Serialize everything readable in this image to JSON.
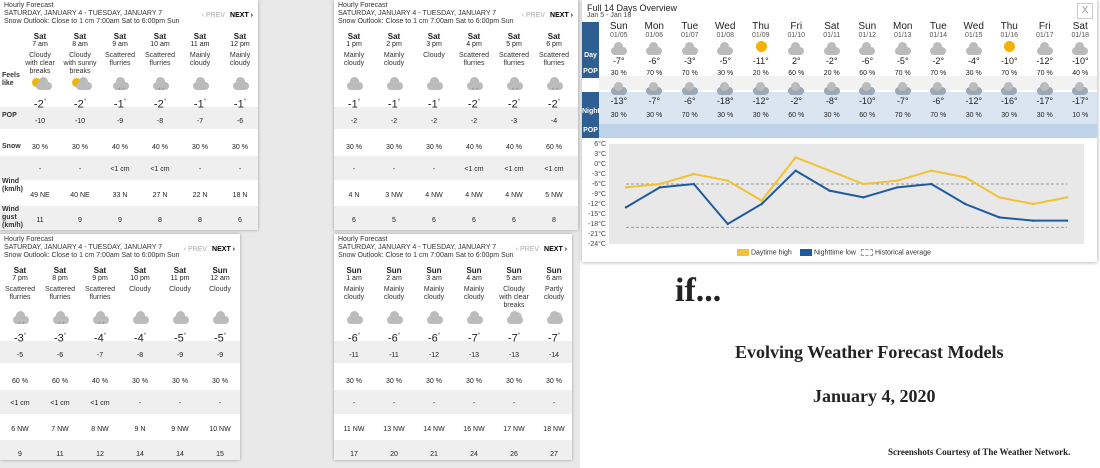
{
  "panels": [
    {
      "id": "p1",
      "title": "Hourly Forecast",
      "range": "SATURDAY, JANUARY 4 - TUESDAY, JANUARY 7",
      "outlook": "Snow Outlook: Close to 1 cm 7:00am Sat to 6:00pm Sun",
      "prev": "‹ PREV",
      "next": "NEXT ›",
      "labels": [
        "Feels like",
        "POP",
        "Snow",
        "Wind (km/h)",
        "Wind gust (km/h)"
      ],
      "cols": [
        {
          "day": "Sat",
          "time": "7 am",
          "cond": "Cloudy with clear breaks",
          "icon": "cloud-sun-icon",
          "temp": "-2",
          "feels": "-10",
          "pop": "30 %",
          "snow": "-",
          "wind": "49 NE",
          "gust": "11"
        },
        {
          "day": "Sat",
          "time": "8 am",
          "cond": "Cloudy with sunny breaks",
          "icon": "cloud-sun-icon",
          "temp": "-2",
          "feels": "-10",
          "pop": "30 %",
          "snow": "-",
          "wind": "40 NE",
          "gust": "9"
        },
        {
          "day": "Sat",
          "time": "9 am",
          "cond": "Scattered flurries",
          "icon": "flurries-icon",
          "temp": "-1",
          "feels": "-9",
          "pop": "40 %",
          "snow": "<1 cm",
          "wind": "33 N",
          "gust": "9"
        },
        {
          "day": "Sat",
          "time": "10 am",
          "cond": "Scattered flurries",
          "icon": "flurries-icon",
          "temp": "-2",
          "feels": "-8",
          "pop": "40 %",
          "snow": "<1 cm",
          "wind": "27 N",
          "gust": "8"
        },
        {
          "day": "Sat",
          "time": "11 am",
          "cond": "Mainly cloudy",
          "icon": "cloud-icon",
          "temp": "-1",
          "feels": "-7",
          "pop": "30 %",
          "snow": "-",
          "wind": "22 N",
          "gust": "8"
        },
        {
          "day": "Sat",
          "time": "12 pm",
          "cond": "Mainly cloudy",
          "icon": "cloud-icon",
          "temp": "-1",
          "feels": "-6",
          "pop": "30 %",
          "snow": "-",
          "wind": "18 N",
          "gust": "6"
        }
      ]
    },
    {
      "id": "p2",
      "title": "Hourly Forecast",
      "range": "SATURDAY, JANUARY 4 - TUESDAY, JANUARY 7",
      "outlook": "Snow Outlook: Close to 1 cm 7:00am Sat to 6:00pm Sun",
      "prev": "‹ PREV",
      "next": "NEXT ›",
      "cols": [
        {
          "day": "Sat",
          "time": "1 pm",
          "cond": "Mainly cloudy",
          "icon": "cloud-icon",
          "temp": "-1",
          "feels": "-2",
          "pop": "30 %",
          "snow": "-",
          "wind": "4 N",
          "gust": "6"
        },
        {
          "day": "Sat",
          "time": "2 pm",
          "cond": "Mainly cloudy",
          "icon": "cloud-icon",
          "temp": "-1",
          "feels": "-2",
          "pop": "30 %",
          "snow": "-",
          "wind": "3 NW",
          "gust": "5"
        },
        {
          "day": "Sat",
          "time": "3 pm",
          "cond": "Cloudy",
          "icon": "cloud-icon",
          "temp": "-1",
          "feels": "-2",
          "pop": "30 %",
          "snow": "-",
          "wind": "4 NW",
          "gust": "6"
        },
        {
          "day": "Sat",
          "time": "4 pm",
          "cond": "Scattered flurries",
          "icon": "flurries-icon",
          "temp": "-2",
          "feels": "-2",
          "pop": "40 %",
          "snow": "<1 cm",
          "wind": "4 NW",
          "gust": "6"
        },
        {
          "day": "Sat",
          "time": "5 pm",
          "cond": "Scattered flurries",
          "icon": "flurries-icon",
          "temp": "-2",
          "feels": "-3",
          "pop": "40 %",
          "snow": "<1 cm",
          "wind": "4 NW",
          "gust": "6"
        },
        {
          "day": "Sat",
          "time": "6 pm",
          "cond": "Scattered flurries",
          "icon": "flurries-icon",
          "temp": "-2",
          "feels": "-4",
          "pop": "60 %",
          "snow": "<1 cm",
          "wind": "5 NW",
          "gust": "8"
        }
      ]
    },
    {
      "id": "p3",
      "title": "Hourly Forecast",
      "range": "SATURDAY, JANUARY 4 - TUESDAY, JANUARY 7",
      "outlook": "Snow Outlook: Close to 1 cm 7:00am Sat to 6:00pm Sun",
      "prev": "‹ PREV",
      "next": "NEXT ›",
      "cols": [
        {
          "day": "Sat",
          "time": "7 pm",
          "cond": "Scattered flurries",
          "icon": "flurries-icon",
          "temp": "-3",
          "feels": "-5",
          "pop": "60 %",
          "snow": "<1 cm",
          "wind": "6 NW",
          "gust": "9"
        },
        {
          "day": "Sat",
          "time": "8 pm",
          "cond": "Scattered flurries",
          "icon": "flurries-icon",
          "temp": "-3",
          "feels": "-6",
          "pop": "60 %",
          "snow": "<1 cm",
          "wind": "7 NW",
          "gust": "11"
        },
        {
          "day": "Sat",
          "time": "9 pm",
          "cond": "Scattered flurries",
          "icon": "flurries-icon",
          "temp": "-4",
          "feels": "-7",
          "pop": "40 %",
          "snow": "<1 cm",
          "wind": "8 NW",
          "gust": "12"
        },
        {
          "day": "Sat",
          "time": "10 pm",
          "cond": "Cloudy",
          "icon": "cloud-icon",
          "temp": "-4",
          "feels": "-8",
          "pop": "30 %",
          "snow": "-",
          "wind": "9 N",
          "gust": "14"
        },
        {
          "day": "Sat",
          "time": "11 pm",
          "cond": "Cloudy",
          "icon": "cloud-icon",
          "temp": "-5",
          "feels": "-9",
          "pop": "30 %",
          "snow": "-",
          "wind": "9 NW",
          "gust": "14"
        },
        {
          "day": "Sun",
          "time": "12 am",
          "cond": "Cloudy",
          "icon": "cloud-icon",
          "temp": "-5",
          "feels": "-9",
          "pop": "30 %",
          "snow": "-",
          "wind": "10 NW",
          "gust": "15"
        }
      ]
    },
    {
      "id": "p4",
      "title": "Hourly Forecast",
      "range": "SATURDAY, JANUARY 4 - TUESDAY, JANUARY 7",
      "outlook": "Snow Outlook: Close to 1 cm 7:00am Sat to 6:00pm Sun",
      "prev": "‹ PREV",
      "next": "NEXT ›",
      "cols": [
        {
          "day": "Sun",
          "time": "1 am",
          "cond": "Mainly cloudy",
          "icon": "cloud-icon",
          "temp": "-6",
          "feels": "-11",
          "pop": "30 %",
          "snow": "-",
          "wind": "11 NW",
          "gust": "17"
        },
        {
          "day": "Sun",
          "time": "2 am",
          "cond": "Mainly cloudy",
          "icon": "cloud-icon",
          "temp": "-6",
          "feels": "-11",
          "pop": "30 %",
          "snow": "-",
          "wind": "13 NW",
          "gust": "20"
        },
        {
          "day": "Sun",
          "time": "3 am",
          "cond": "Mainly cloudy",
          "icon": "cloud-icon",
          "temp": "-6",
          "feels": "-12",
          "pop": "30 %",
          "snow": "-",
          "wind": "14 NW",
          "gust": "21"
        },
        {
          "day": "Sun",
          "time": "4 am",
          "cond": "Mainly cloudy",
          "icon": "cloud-icon",
          "temp": "-7",
          "feels": "-13",
          "pop": "30 %",
          "snow": "-",
          "wind": "16 NW",
          "gust": "24"
        },
        {
          "day": "Sun",
          "time": "5 am",
          "cond": "Cloudy with clear breaks",
          "icon": "cloud-moon-icon",
          "temp": "-7",
          "feels": "-13",
          "pop": "30 %",
          "snow": "-",
          "wind": "17 NW",
          "gust": "26"
        },
        {
          "day": "Sun",
          "time": "6 am",
          "cond": "Partly cloudy",
          "icon": "cloud-moon-icon",
          "temp": "-7",
          "feels": "-14",
          "pop": "30 %",
          "snow": "-",
          "wind": "18 NW",
          "gust": "27"
        }
      ]
    }
  ],
  "overview": {
    "title": "Full 14 Days Overview",
    "subtitle": "Jan 5 - Jan 18",
    "close": "X",
    "day_label": "Day",
    "night_label": "Night",
    "pop_label": "POP",
    "colors": {
      "day_bg": "#7aa3c8",
      "night_bg": "#d9e6f2",
      "label_bg": "#2f5f92"
    },
    "days": [
      {
        "name": "Sun",
        "date": "01/05",
        "hi": "-7°",
        "dpop": "30 %",
        "lo": "-13°",
        "npop": "30 %"
      },
      {
        "name": "Mon",
        "date": "01/06",
        "hi": "-6°",
        "dpop": "70 %",
        "lo": "-7°",
        "npop": "30 %"
      },
      {
        "name": "Tue",
        "date": "01/07",
        "hi": "-3°",
        "dpop": "70 %",
        "lo": "-6°",
        "npop": "70 %"
      },
      {
        "name": "Wed",
        "date": "01/08",
        "hi": "-5°",
        "dpop": "30 %",
        "lo": "-18°",
        "npop": "30 %"
      },
      {
        "name": "Thu",
        "date": "01/09",
        "hi": "-11°",
        "dpop": "20 %",
        "lo": "-12°",
        "npop": "30 %"
      },
      {
        "name": "Fri",
        "date": "01/10",
        "hi": "2°",
        "dpop": "60 %",
        "lo": "-2°",
        "npop": "60 %"
      },
      {
        "name": "Sat",
        "date": "01/11",
        "hi": "-2°",
        "dpop": "20 %",
        "lo": "-8°",
        "npop": "30 %"
      },
      {
        "name": "Sun",
        "date": "01/12",
        "hi": "-6°",
        "dpop": "60 %",
        "lo": "-10°",
        "npop": "60 %"
      },
      {
        "name": "Mon",
        "date": "01/13",
        "hi": "-5°",
        "dpop": "70 %",
        "lo": "-7°",
        "npop": "70 %"
      },
      {
        "name": "Tue",
        "date": "01/14",
        "hi": "-2°",
        "dpop": "70 %",
        "lo": "-6°",
        "npop": "70 %"
      },
      {
        "name": "Wed",
        "date": "01/15",
        "hi": "-4°",
        "dpop": "30 %",
        "lo": "-12°",
        "npop": "30 %"
      },
      {
        "name": "Thu",
        "date": "01/16",
        "hi": "-10°",
        "dpop": "70 %",
        "lo": "-16°",
        "npop": "30 %"
      },
      {
        "name": "Fri",
        "date": "01/17",
        "hi": "-12°",
        "dpop": "70 %",
        "lo": "-17°",
        "npop": "30 %"
      },
      {
        "name": "Sat",
        "date": "01/18",
        "hi": "-10°",
        "dpop": "40 %",
        "lo": "-17°",
        "npop": "10 %"
      }
    ],
    "legend": {
      "high": "Daytime high",
      "low": "Nighttime low",
      "avg": "Historical average"
    }
  },
  "chart_data": {
    "type": "line",
    "categories": [
      "01/05",
      "01/06",
      "01/07",
      "01/08",
      "01/09",
      "01/10",
      "01/11",
      "01/12",
      "01/13",
      "01/14",
      "01/15",
      "01/16",
      "01/17",
      "01/18"
    ],
    "series": [
      {
        "name": "Daytime high",
        "color": "#f1c232",
        "values": [
          -7,
          -6,
          -3,
          -5,
          -11,
          2,
          -2,
          -6,
          -5,
          -2,
          -4,
          -10,
          -12,
          -10
        ]
      },
      {
        "name": "Nighttime low",
        "color": "#1f5a9e",
        "values": [
          -13,
          -7,
          -6,
          -18,
          -12,
          -2,
          -8,
          -10,
          -7,
          -6,
          -12,
          -16,
          -17,
          -17
        ]
      },
      {
        "name": "Historical average",
        "color": "#999999",
        "values_high": [
          -6,
          -6,
          -6,
          -6,
          -6,
          -6,
          -6,
          -6,
          -6,
          -6,
          -6,
          -6,
          -6,
          -6
        ],
        "values_low": [
          -19,
          -19,
          -19,
          -19,
          -19,
          -19,
          -19,
          -19,
          -19,
          -19,
          -19,
          -19,
          -19,
          -19
        ]
      }
    ],
    "yticks": [
      "6°C",
      "3°C",
      "0°C",
      "-3°C",
      "-6°C",
      "-9°C",
      "-12°C",
      "-15°C",
      "-18°C",
      "-21°C",
      "-24°C"
    ],
    "ylim": [
      -24,
      6
    ],
    "legend_position": "bottom"
  },
  "slide": {
    "if_text": "if...",
    "title": "Evolving Weather Forecast Models",
    "date": "January 4, 2020",
    "credit": "Screenshots Courtesy of The Weather Network."
  }
}
